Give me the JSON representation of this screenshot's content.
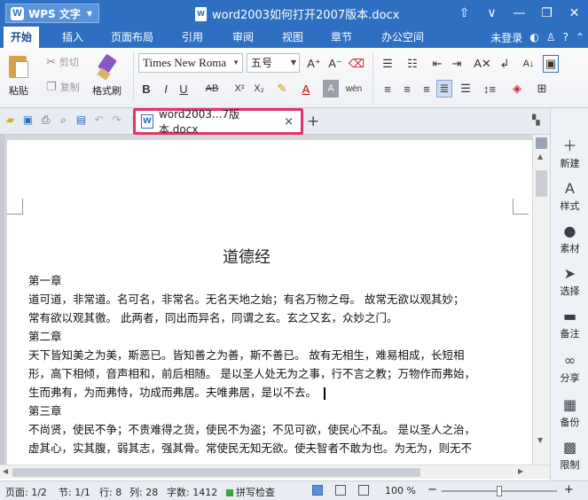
{
  "titlebar": {
    "app_name": "WPS 文字",
    "app_logo": "W",
    "document_title": "word2003如何打开2007版本.docx",
    "doc_icon_letter": "W",
    "controls": [
      "⇧",
      "∨",
      "—",
      "❐",
      "✕"
    ]
  },
  "menubar": {
    "items": [
      "开始",
      "插入",
      "页面布局",
      "引用",
      "审阅",
      "视图",
      "章节",
      "办公空间"
    ],
    "active_index": 0,
    "login_text": "未登录",
    "right_icons": [
      "theme-icon",
      "shirt-icon",
      "help-icon",
      "collapse-icon"
    ]
  },
  "ribbon": {
    "paste_label": "粘贴",
    "cut_label": "剪切",
    "copy_label": "复制",
    "format_painter_label": "格式刷",
    "font_name": "Times New Roma",
    "font_size": "五号",
    "font_buttons": [
      "A⁺",
      "A⁻"
    ],
    "style_buttons": [
      "B",
      "I",
      "U",
      "AB",
      "X²",
      "X₂"
    ]
  },
  "quickbar": {
    "tab_label": "word2003...7版本.docx",
    "tab_icon_letter": "W",
    "tab_close": "×",
    "add_tab": "+"
  },
  "sidepanel": {
    "items": [
      {
        "label": "新建",
        "icon": "new-icon"
      },
      {
        "label": "样式",
        "icon": "style-icon"
      },
      {
        "label": "素材",
        "icon": "material-icon"
      },
      {
        "label": "选择",
        "icon": "select-icon"
      },
      {
        "label": "备注",
        "icon": "note-icon"
      },
      {
        "label": "分享",
        "icon": "share-icon"
      },
      {
        "label": "备份",
        "icon": "backup-icon"
      },
      {
        "label": "限制",
        "icon": "restrict-icon"
      }
    ]
  },
  "document": {
    "title": "道德经",
    "chapters": [
      {
        "heading": "第一章",
        "lines": [
          "道可道，非常道。名可名，非常名。无名天地之始；有名万物之母。 故常无欲以观其妙；",
          "常有欲以观其徼。 此两者，同出而异名，同谓之玄。玄之又玄，众妙之门。"
        ]
      },
      {
        "heading": "第二章",
        "lines": [
          "天下皆知美之为美，斯恶已。皆知善之为善，斯不善已。 故有无相生，难易相成，长短相",
          "形，高下相倾，音声相和，前后相随。 是以圣人处无为之事，行不言之教；万物作而弗始，",
          "生而弗有，为而弗恃，功成而弗居。夫唯弗居，是以不去。"
        ]
      },
      {
        "heading": "第三章",
        "lines": [
          "不尚贤，使民不争；不贵难得之货，使民不为盗；不见可欲，使民心不乱。 是以圣人之治，",
          "虚其心，实其腹，弱其志，强其骨。常使民无知无欲。使夫智者不敢为也。为无为，则无不"
        ]
      }
    ]
  },
  "statusbar": {
    "page": "页面: 1/2",
    "section": "节: 1/1",
    "row": "行: 8",
    "col": "列: 28",
    "word_count": "字数: 1412",
    "spell_check": "拼写检查",
    "zoom": "100 %",
    "zoom_level_percent": 100
  },
  "colors": {
    "titlebar": "#2f6fc2",
    "tab_highlight": "#e3336b"
  }
}
